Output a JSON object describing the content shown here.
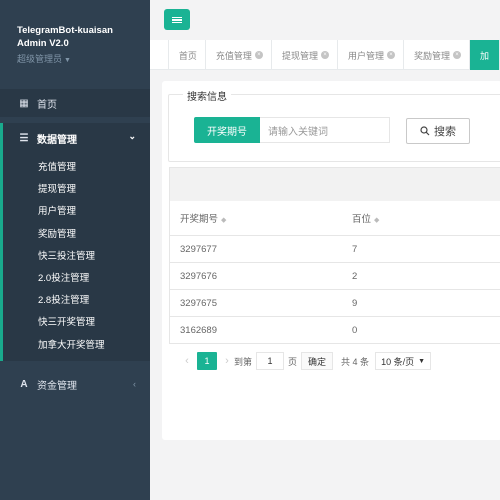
{
  "sidebar": {
    "app_title_line1": "TelegramBot-kuaisan",
    "app_title_line2": "Admin V2.0",
    "role": "超级管理员",
    "home": "首页",
    "data_mgmt": "数据管理",
    "sub_items": [
      "充值管理",
      "提现管理",
      "用户管理",
      "奖励管理",
      "快三投注管理",
      "2.0投注管理",
      "2.8投注管理",
      "快三开奖管理",
      "加拿大开奖管理"
    ],
    "funds_mgmt": "资金管理"
  },
  "tabs": [
    {
      "label": "首页",
      "closable": false
    },
    {
      "label": "充值管理",
      "closable": true
    },
    {
      "label": "提现管理",
      "closable": true
    },
    {
      "label": "用户管理",
      "closable": true
    },
    {
      "label": "奖励管理",
      "closable": true
    },
    {
      "label": "加",
      "closable": false
    }
  ],
  "search": {
    "legend": "搜索信息",
    "field_label": "开奖期号",
    "placeholder": "请输入关键词",
    "button": "搜索"
  },
  "table": {
    "columns": [
      "开奖期号",
      "百位"
    ],
    "rows": [
      [
        "3297677",
        "7"
      ],
      [
        "3297676",
        "2"
      ],
      [
        "3297675",
        "9"
      ],
      [
        "3162689",
        "0"
      ]
    ]
  },
  "pager": {
    "current_page": "1",
    "goto_label": "到第",
    "goto_value": "1",
    "page_unit": "页",
    "confirm": "确定",
    "total": "共 4 条",
    "page_size": "10 条/页"
  },
  "colors": {
    "accent": "#1ab394",
    "sidebar_bg": "#2f4050",
    "sidebar_active": "#293846"
  }
}
